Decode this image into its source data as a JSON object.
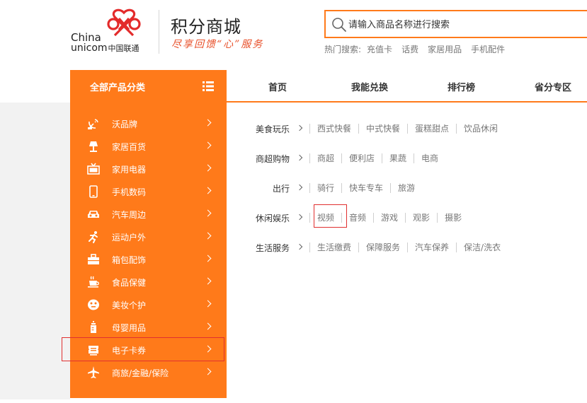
{
  "brand": {
    "logo_line1": "China",
    "logo_line2_en": "unicom",
    "logo_line2_cn": "中国联通",
    "site_title": "积分商城",
    "slogan": "尽享回馈“心”服务"
  },
  "search": {
    "placeholder": "请输入商品名称进行搜索"
  },
  "hot_search": {
    "label": "热门搜索:",
    "links": [
      "充值卡",
      "话费",
      "家居用品",
      "手机配件"
    ]
  },
  "category_header": {
    "label": "全部产品分类"
  },
  "nav": {
    "tabs": [
      "首页",
      "我能兑换",
      "排行榜",
      "省分专区"
    ]
  },
  "sidebar": {
    "items": [
      {
        "label": "沃品牌",
        "icon": "satellite-dish-icon"
      },
      {
        "label": "家居百货",
        "icon": "lamp-icon"
      },
      {
        "label": "家用电器",
        "icon": "tv-icon"
      },
      {
        "label": "手机数码",
        "icon": "phone-icon"
      },
      {
        "label": "汽车周边",
        "icon": "car-icon"
      },
      {
        "label": "运动户外",
        "icon": "runner-icon"
      },
      {
        "label": "箱包配饰",
        "icon": "bag-icon"
      },
      {
        "label": "食品保健",
        "icon": "coffee-cup-icon"
      },
      {
        "label": "美妆个护",
        "icon": "face-mask-icon"
      },
      {
        "label": "母婴用品",
        "icon": "baby-bottle-icon"
      },
      {
        "label": "电子卡券",
        "icon": "card-voucher-icon"
      },
      {
        "label": "商旅/金融/保险",
        "icon": "airplane-icon"
      }
    ]
  },
  "submenu": {
    "rows": [
      {
        "title": "美食玩乐",
        "links": [
          "西式快餐",
          "中式快餐",
          "蛋糕甜点",
          "饮品休闲"
        ]
      },
      {
        "title": "商超购物",
        "links": [
          "商超",
          "便利店",
          "果蔬",
          "电商"
        ]
      },
      {
        "title": "出行",
        "links": [
          "骑行",
          "快车专车",
          "旅游"
        ]
      },
      {
        "title": "休闲娱乐",
        "links": [
          "视频",
          "音频",
          "游戏",
          "观影",
          "摄影"
        ]
      },
      {
        "title": "生活服务",
        "links": [
          "生活缴费",
          "保障服务",
          "汽车保养",
          "保洁/洗衣"
        ]
      }
    ]
  },
  "colors": {
    "accent": "#ff7a1a",
    "brand_red": "#e8502a",
    "highlight": "#e03030"
  }
}
